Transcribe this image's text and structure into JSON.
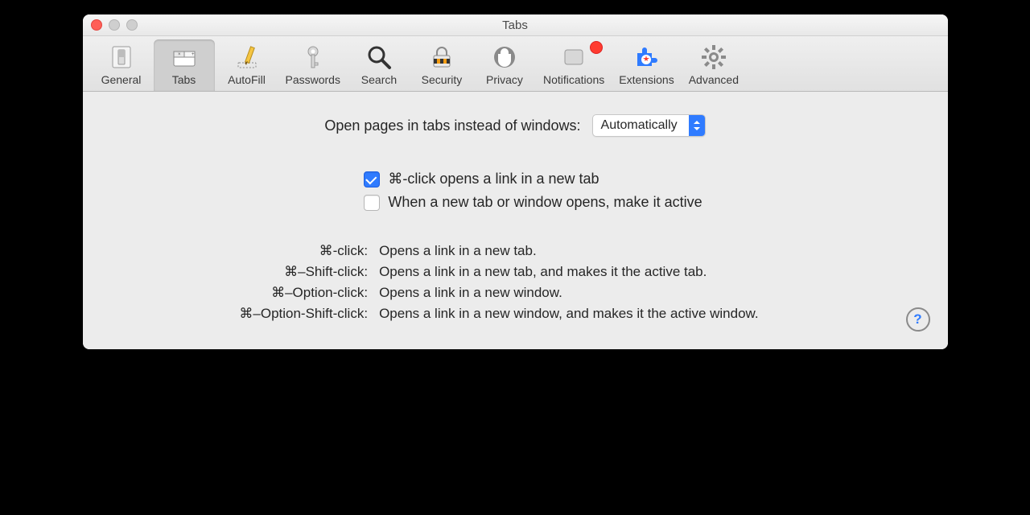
{
  "window": {
    "title": "Tabs"
  },
  "toolbar": [
    {
      "id": "general",
      "label": "General"
    },
    {
      "id": "tabs",
      "label": "Tabs"
    },
    {
      "id": "autofill",
      "label": "AutoFill"
    },
    {
      "id": "passwords",
      "label": "Passwords"
    },
    {
      "id": "search",
      "label": "Search"
    },
    {
      "id": "security",
      "label": "Security"
    },
    {
      "id": "privacy",
      "label": "Privacy"
    },
    {
      "id": "notifications",
      "label": "Notifications",
      "badge": true
    },
    {
      "id": "extensions",
      "label": "Extensions"
    },
    {
      "id": "advanced",
      "label": "Advanced"
    }
  ],
  "toolbar_selected": "tabs",
  "open_tabs": {
    "label": "Open pages in tabs instead of windows:",
    "value": "Automatically"
  },
  "checkboxes": {
    "cmd_click": {
      "label": "⌘-click opens a link in a new tab",
      "checked": true
    },
    "make_active": {
      "label": "When a new tab or window opens, make it active",
      "checked": false
    }
  },
  "shortcuts": [
    {
      "keys": "⌘-click:",
      "desc": "Opens a link in a new tab."
    },
    {
      "keys": "⌘–Shift-click:",
      "desc": "Opens a link in a new tab, and makes it the active tab."
    },
    {
      "keys": "⌘–Option-click:",
      "desc": "Opens a link in a new window."
    },
    {
      "keys": "⌘–Option-Shift-click:",
      "desc": "Opens a link in a new window, and makes it the active window."
    }
  ],
  "help_label": "?"
}
